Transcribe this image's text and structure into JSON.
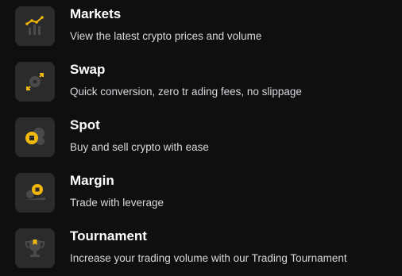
{
  "accent_color": "#f0b90b",
  "items": [
    {
      "icon": "markets-chart-icon",
      "title": "Markets",
      "description": "View the latest crypto prices and volume"
    },
    {
      "icon": "swap-icon",
      "title": "Swap",
      "description": "Quick conversion, zero tr ading fees, no slippage"
    },
    {
      "icon": "spot-coin-icon",
      "title": "Spot",
      "description": "Buy and sell crypto with ease"
    },
    {
      "icon": "margin-coin-icon",
      "title": "Margin",
      "description": "Trade with leverage"
    },
    {
      "icon": "trophy-icon",
      "title": "Tournament",
      "description": "Increase your trading volume with our Trading Tournament"
    }
  ]
}
